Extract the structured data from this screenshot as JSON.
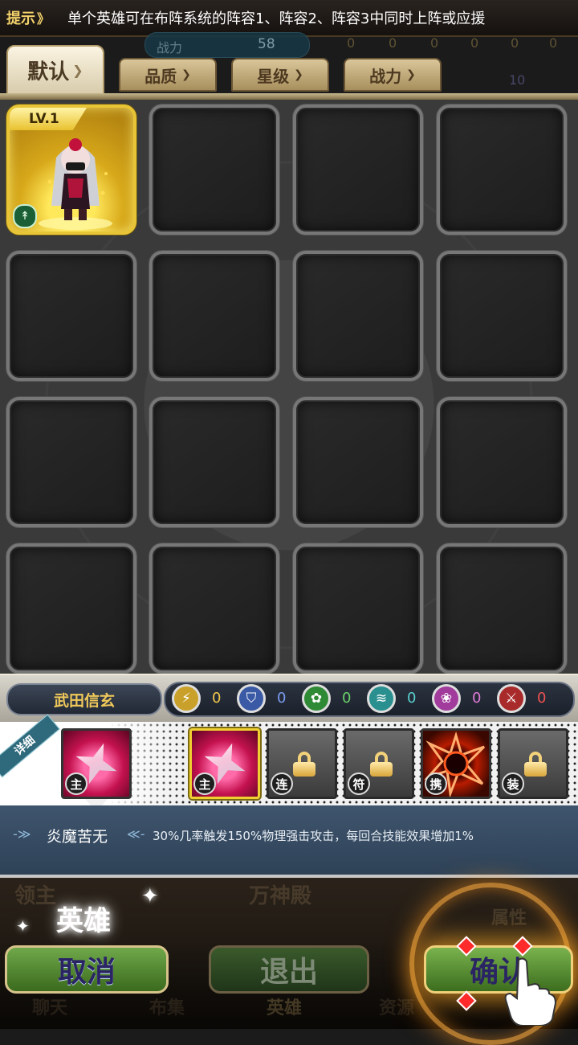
{
  "hint": {
    "tag": "提示",
    "tag_arrow": "》",
    "text": "单个英雄可在布阵系统的阵容1、阵容2、阵容3中同时上阵或应援"
  },
  "background_status": {
    "power_label": "战力",
    "power_value": "58",
    "attr_counts": [
      "0",
      "0",
      "0",
      "0",
      "0",
      "0"
    ],
    "partial_count": "10"
  },
  "tabs": [
    {
      "label": "默认",
      "active": true
    },
    {
      "label": "品质",
      "active": false
    },
    {
      "label": "星级",
      "active": false
    },
    {
      "label": "战力",
      "active": false
    }
  ],
  "grid": {
    "hero": {
      "level": "LV.1",
      "class_icon": "bow-class-icon"
    }
  },
  "selected_hero": {
    "name": "武田信玄",
    "attributes": [
      {
        "icon": "lightning-icon",
        "value": "0",
        "color": "#c9a12a"
      },
      {
        "icon": "shield-icon",
        "value": "0",
        "color": "#3a5aa6"
      },
      {
        "icon": "flower-icon",
        "value": "0",
        "color": "#2f8a35"
      },
      {
        "icon": "wind-icon",
        "value": "0",
        "color": "#2a8f8f"
      },
      {
        "icon": "heart-flower-icon",
        "value": "0",
        "color": "#a13c9c"
      },
      {
        "icon": "sword-icon",
        "value": "0",
        "color": "#a82a2a"
      }
    ]
  },
  "skills": {
    "detail_label": "详细",
    "featured_type": "主",
    "slots": [
      {
        "type": "主",
        "state": "selected"
      },
      {
        "type": "连",
        "state": "locked"
      },
      {
        "type": "符",
        "state": "locked"
      },
      {
        "type": "携",
        "state": "bond"
      },
      {
        "type": "装",
        "state": "locked"
      }
    ]
  },
  "description": {
    "arrow_left": "-≫",
    "arrow_right": "≪-",
    "skill_name": "炎魔苦无",
    "text": "30%几率触发150%物理强击攻击，每回合技能效果增加1%"
  },
  "bottom": {
    "title": "英雄",
    "ghost_labels": [
      "领主",
      "万神殿",
      "属性",
      "聊天",
      "布集",
      "英雄",
      "资源"
    ],
    "cancel_label": "取消",
    "exit_label": "退出",
    "confirm_label": "确认"
  }
}
